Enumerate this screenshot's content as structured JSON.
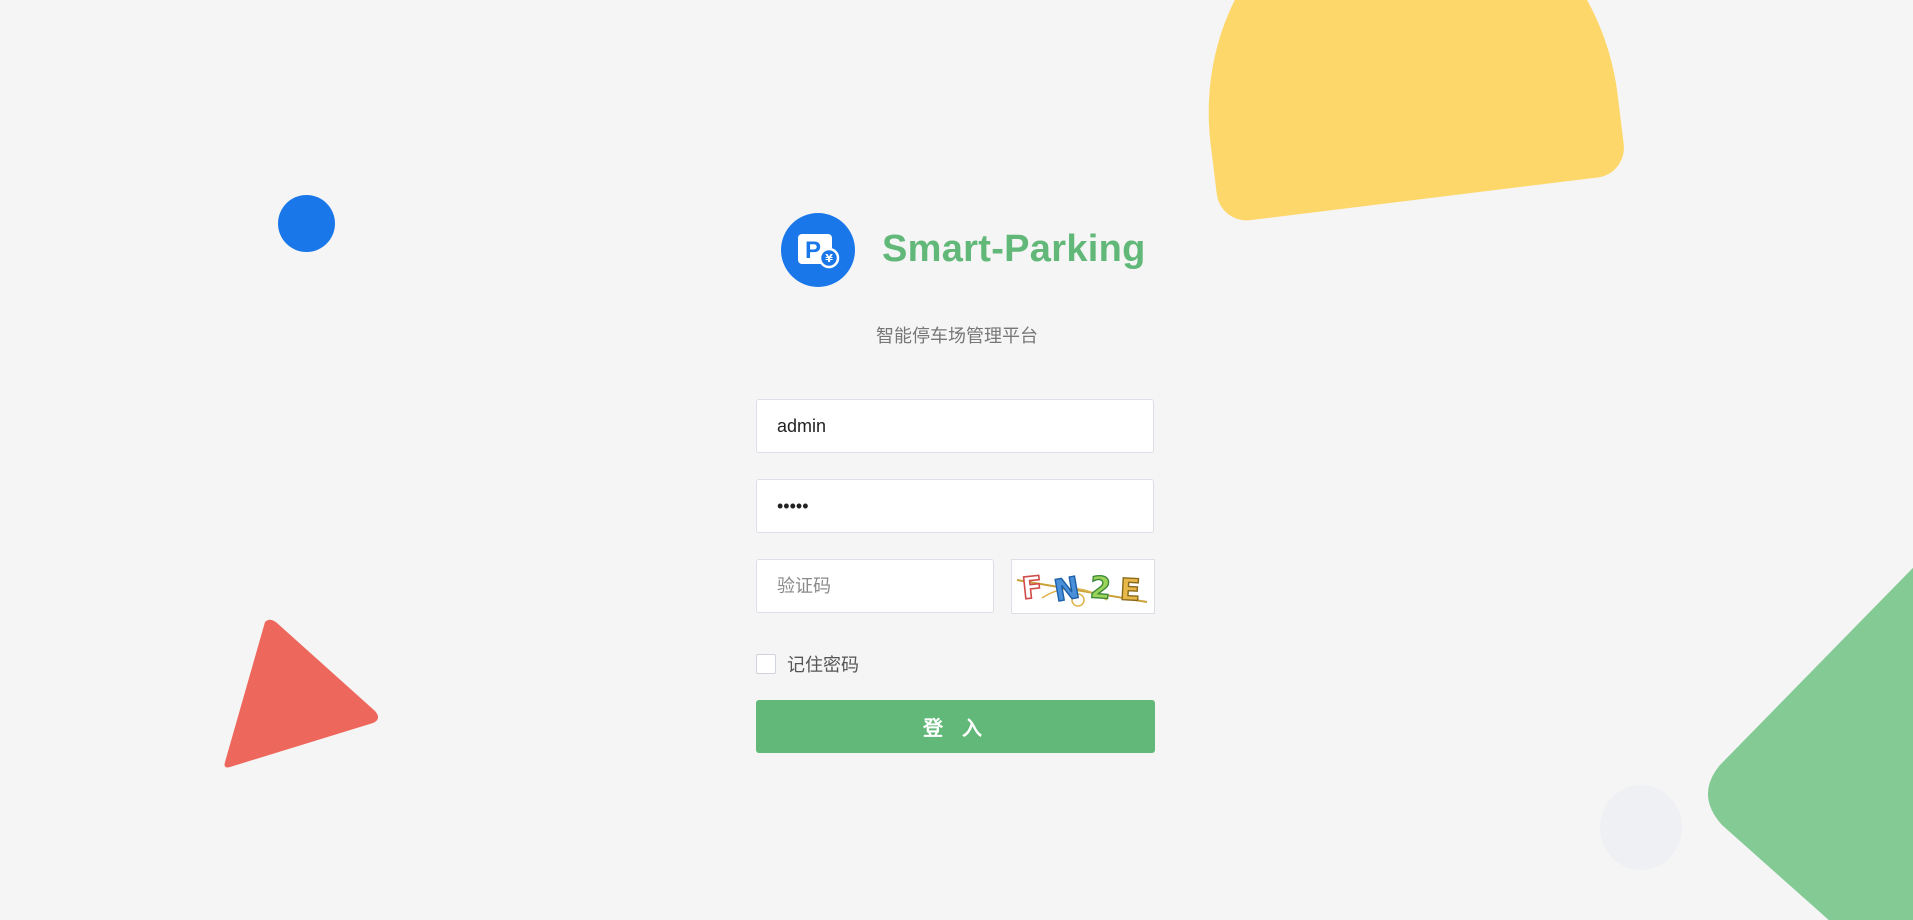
{
  "brand": {
    "title": "Smart-Parking",
    "subtitle": "智能停车场管理平台",
    "logo_icon": "parking-yuan-icon"
  },
  "form": {
    "username": {
      "value": "admin"
    },
    "password": {
      "value": "12345"
    },
    "captcha": {
      "value": "",
      "placeholder": "验证码",
      "image_text": "FN2E"
    },
    "remember": {
      "label": "记住密码",
      "checked": false
    },
    "submit_label": "登 入"
  },
  "colors": {
    "primary_green": "#62b879",
    "brand_blue": "#1a77ea",
    "deco_yellow": "#fdd76a",
    "deco_red": "#ee675c",
    "deco_green": "#83ca95",
    "background": "#f5f5f5"
  }
}
